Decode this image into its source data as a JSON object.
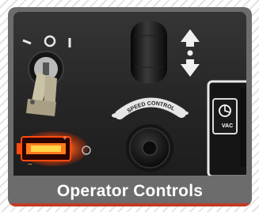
{
  "caption": "Operator Controls",
  "panel": {
    "speed_control_label": "SPEED CONTROL",
    "vac_label": "VAC",
    "key_switch_off_symbol": "O",
    "key_switch_on_symbol": "I"
  },
  "icons": {
    "battery": "battery-indicator-icon",
    "direction": "up-down-arrow-icon",
    "vacuum": "vacuum-fan-icon"
  },
  "colors": {
    "card": "#6c6c6c",
    "battery_led": "#ff5a1a",
    "caption_text": "#ffffff"
  }
}
